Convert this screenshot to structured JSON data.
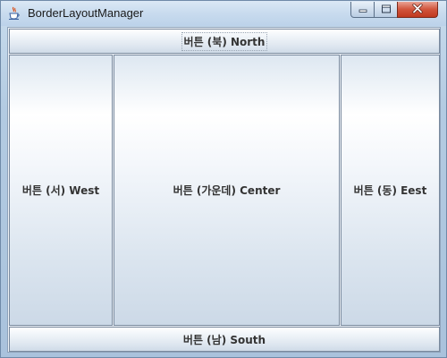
{
  "window": {
    "title": "BorderLayoutManager",
    "app_icon": "java-cup-icon",
    "controls": {
      "minimize_icon": "minimize-icon",
      "maximize_icon": "maximize-icon",
      "close_icon": "close-icon"
    },
    "colors": {
      "close_button": "#c8452c",
      "frame": "#b3cbe2"
    }
  },
  "layout_buttons": {
    "north": "버튼 (북) North",
    "west": "버튼 (서) West",
    "center": "버튼 (가운데) Center",
    "east": "버튼 (동) Eest",
    "south": "버튼 (남) South"
  }
}
